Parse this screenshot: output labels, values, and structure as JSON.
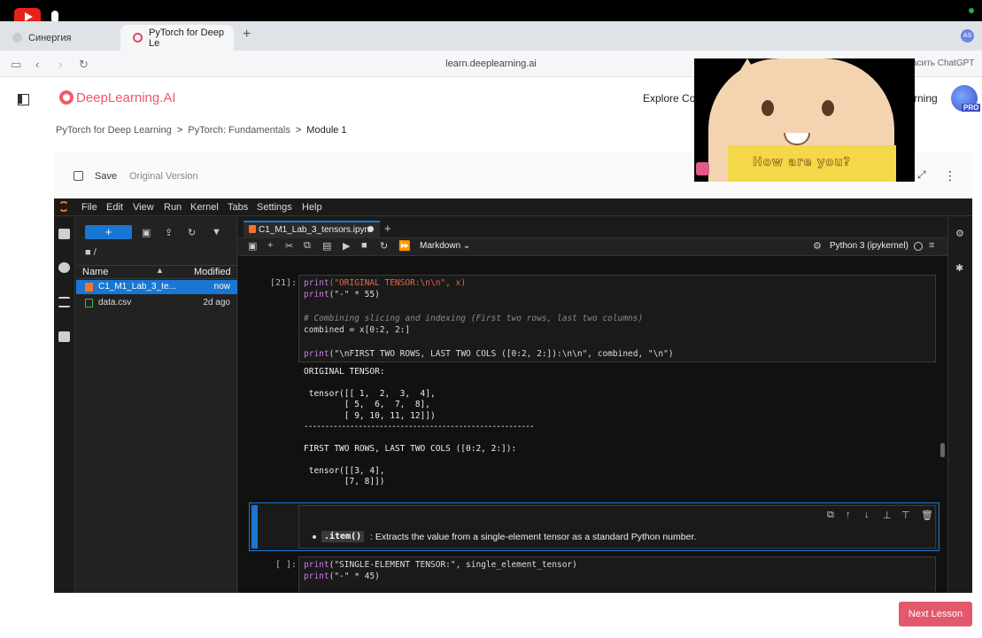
{
  "browser": {
    "tabs": [
      {
        "label": "Синергия"
      },
      {
        "label": "PyTorch for Deep Le"
      }
    ],
    "new_tab": "+",
    "url": "learn.deeplearning.ai",
    "extension_text": "асить ChatGPT",
    "profile_initials": "AS"
  },
  "site": {
    "logo": "DeepLearning.AI",
    "nav_explore": "Explore Cou",
    "nav_learning": "rning",
    "pro_badge": "PRO"
  },
  "breadcrumb": [
    "PyTorch for Deep Learning",
    "PyTorch: Fundamentals",
    "Module 1"
  ],
  "breadcrumb_sep": ">",
  "lab_toolbar": {
    "save": "Save",
    "original_version": "Original Version"
  },
  "jupyter": {
    "menu": [
      "File",
      "Edit",
      "View",
      "Run",
      "Kernel",
      "Tabs",
      "Settings",
      "Help"
    ],
    "filebrowser": {
      "path": "/",
      "col_name": "Name",
      "col_modified": "Modified",
      "files": [
        {
          "name": "C1_M1_Lab_3_te...",
          "modified": "now"
        },
        {
          "name": "data.csv",
          "modified": "2d ago"
        }
      ]
    },
    "notebook_tab": "C1_M1_Lab_3_tensors.ipyn",
    "cell_type": "Markdown",
    "kernel": "Python 3 (ipykernel)",
    "cell21": {
      "prompt": "[21]:",
      "l1_fn": "print",
      "l1_str": "(\"ORIGINAL TENSOR:\\n\\n\", x)",
      "l2_fn": "print",
      "l2_rest": "(\"-\" * 55)",
      "l3_comment": "# Combining slicing and indexing (First two rows, last two columns)",
      "l4": "combined = x[0:2, 2:]",
      "l5_fn": "print",
      "l5_rest": "(\"\\nFIRST TWO ROWS, LAST TWO COLS ([0:2, 2:]):\\n\\n\", combined, \"\\n\")"
    },
    "output21": {
      "o1": "ORIGINAL TENSOR:",
      "o2": " tensor([[ 1,  2,  3,  4],",
      "o3": "        [ 5,  6,  7,  8],",
      "o4": "        [ 9, 10, 11, 12]])",
      "o5": "-------------------------------------------------------",
      "o6": "FIRST TWO ROWS, LAST TWO COLS ([0:2, 2:]):",
      "o7": " tensor([[3, 4],",
      "o8": "        [7, 8]])"
    },
    "markdown_cell": {
      "code": ".item()",
      "text": ": Extracts the value from a single-element tensor as a standard Python number."
    },
    "next_cell": {
      "prompt": "[ ]:",
      "l1_fn": "print",
      "l1_rest": "(\"SINGLE-ELEMENT TENSOR:\", single_element_tensor)",
      "l2_fn": "print",
      "l2_rest": "(\"-\" * 45)"
    }
  },
  "overlay_caption": "How are you?",
  "next_lesson": "Next Lesson"
}
